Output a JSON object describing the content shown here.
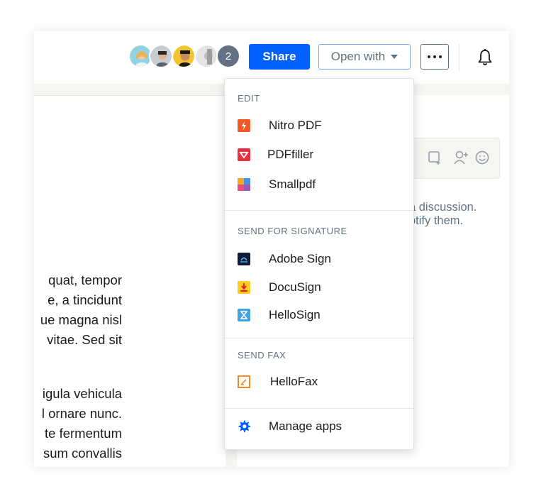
{
  "header": {
    "collaborators": [
      {
        "name": "avatar-1",
        "bg": "#e9c46a"
      },
      {
        "name": "avatar-2",
        "bg": "#b0b7bd"
      },
      {
        "name": "avatar-3",
        "bg": "#f2c530"
      },
      {
        "name": "avatar-4",
        "bg": "#d6d6d6"
      }
    ],
    "extra_count": "2",
    "share_label": "Share",
    "open_with_label": "Open with"
  },
  "document": {
    "lines_top": [
      "quat, tempor",
      "e, a tincidunt",
      "ue magna nisl",
      "vitae. Sed sit"
    ],
    "lines_bottom": [
      "igula vehicula",
      "l ornare nunc.",
      "te fermentum",
      "sum convallis"
    ]
  },
  "sidebar": {
    "dash": "-",
    "text_line1": "a discussion.",
    "text_line2": "otify them."
  },
  "menu": {
    "edit_title": "EDIT",
    "edit_items": [
      "Nitro PDF",
      "PDFfiller",
      "Smallpdf"
    ],
    "signature_title": "SEND FOR SIGNATURE",
    "signature_items": [
      "Adobe Sign",
      "DocuSign",
      "HelloSign"
    ],
    "fax_title": "SEND FAX",
    "fax_items": [
      "HelloFax"
    ],
    "manage_label": "Manage apps"
  },
  "colors": {
    "accent": "#0061fe",
    "nitro": "#f05a28",
    "pdffiller": "#e5323f",
    "adobe": "#0e1b3b",
    "docusign": "#ffcc22",
    "hellosign": "#3fa6e0",
    "hellofax": "#f28b24"
  }
}
